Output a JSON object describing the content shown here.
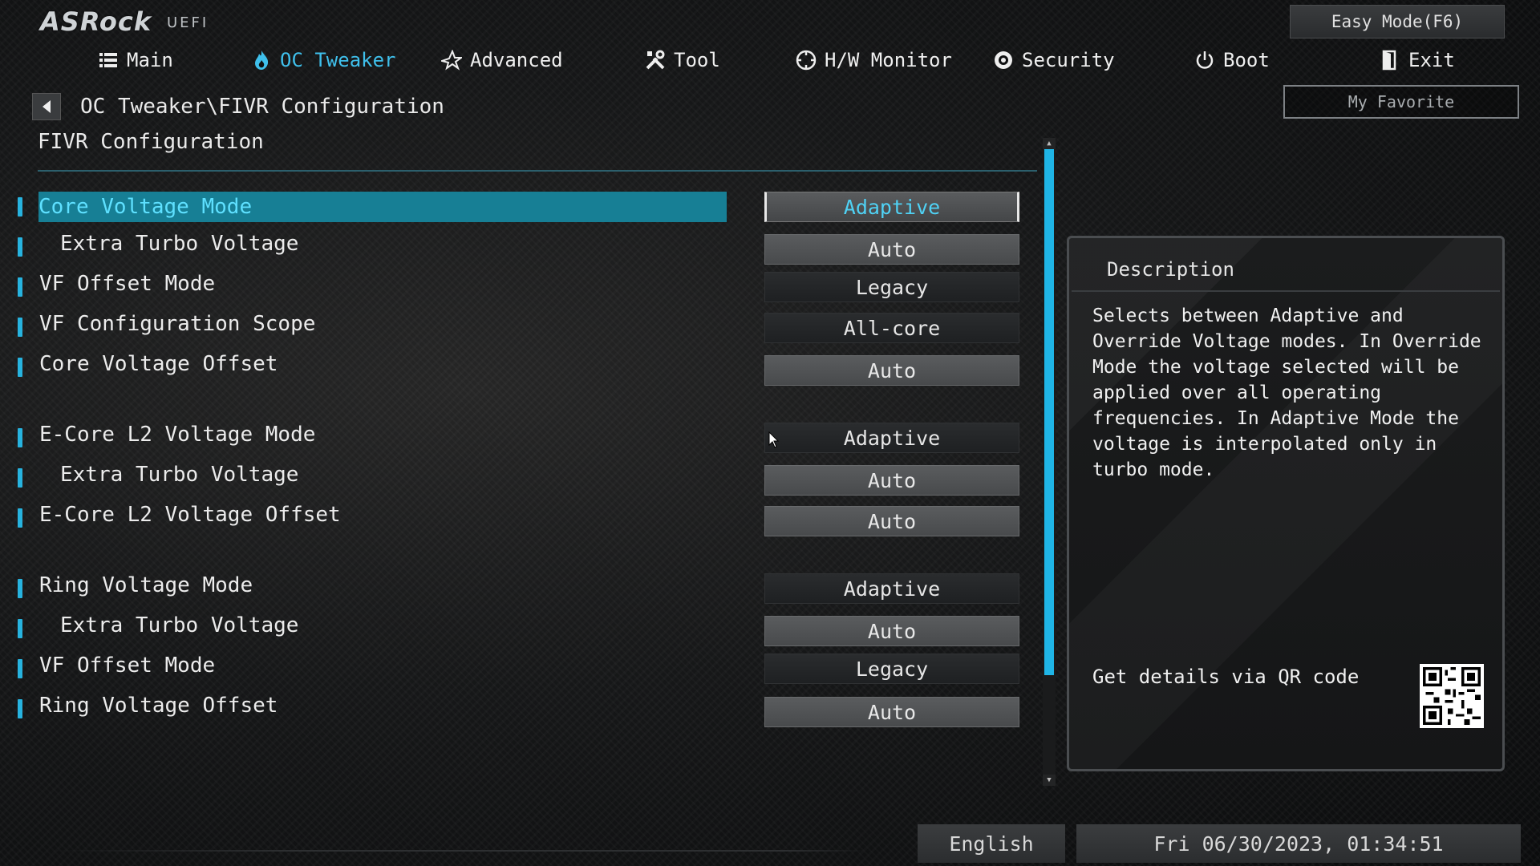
{
  "branding": {
    "logo": "ASRock",
    "sub": "UEFI"
  },
  "top_buttons": {
    "easy_mode": "Easy Mode(F6)",
    "my_favorite": "My Favorite"
  },
  "tabs": [
    {
      "label": "Main",
      "icon": "list-icon",
      "active": false
    },
    {
      "label": "OC Tweaker",
      "icon": "flame-icon",
      "active": true
    },
    {
      "label": "Advanced",
      "icon": "star-icon",
      "active": false
    },
    {
      "label": "Tool",
      "icon": "tools-icon",
      "active": false
    },
    {
      "label": "H/W Monitor",
      "icon": "monitor-icon",
      "active": false
    },
    {
      "label": "Security",
      "icon": "shield-icon",
      "active": false
    },
    {
      "label": "Boot",
      "icon": "power-icon",
      "active": false
    },
    {
      "label": "Exit",
      "icon": "exit-icon",
      "active": false
    }
  ],
  "breadcrumb": "OC Tweaker\\FIVR Configuration",
  "page_title": "FIVR Configuration",
  "settings": [
    {
      "label": "Core Voltage Mode",
      "value": "Adaptive",
      "selected": true
    },
    {
      "label": "Extra Turbo Voltage",
      "value": "Auto",
      "indent": true
    },
    {
      "label": "VF Offset Mode",
      "value": "Legacy"
    },
    {
      "label": "VF Configuration Scope",
      "value": "All-core"
    },
    {
      "label": "Core Voltage Offset",
      "value": "Auto"
    },
    {
      "label": "E-Core L2 Voltage Mode",
      "value": "Adaptive"
    },
    {
      "label": "Extra Turbo Voltage",
      "value": "Auto",
      "indent": true
    },
    {
      "label": "E-Core L2 Voltage Offset",
      "value": "Auto"
    },
    {
      "label": "Ring Voltage Mode",
      "value": "Adaptive"
    },
    {
      "label": "Extra Turbo Voltage",
      "value": "Auto",
      "indent": true
    },
    {
      "label": "VF Offset Mode",
      "value": "Legacy"
    },
    {
      "label": "Ring Voltage Offset",
      "value": "Auto"
    }
  ],
  "description": {
    "header": "Description",
    "text": "Selects between Adaptive and Override Voltage modes. In Override Mode the voltage selected will be applied over all operating frequencies. In Adaptive Mode the voltage is interpolated only in turbo mode.",
    "qr_label": "Get details via QR code"
  },
  "footer": {
    "language": "English",
    "datetime": "Fri 06/30/2023, 01:34:51"
  },
  "colors": {
    "accent": "#27b3df",
    "selected_row": "#177f95",
    "active_tab": "#3fc0ec"
  }
}
